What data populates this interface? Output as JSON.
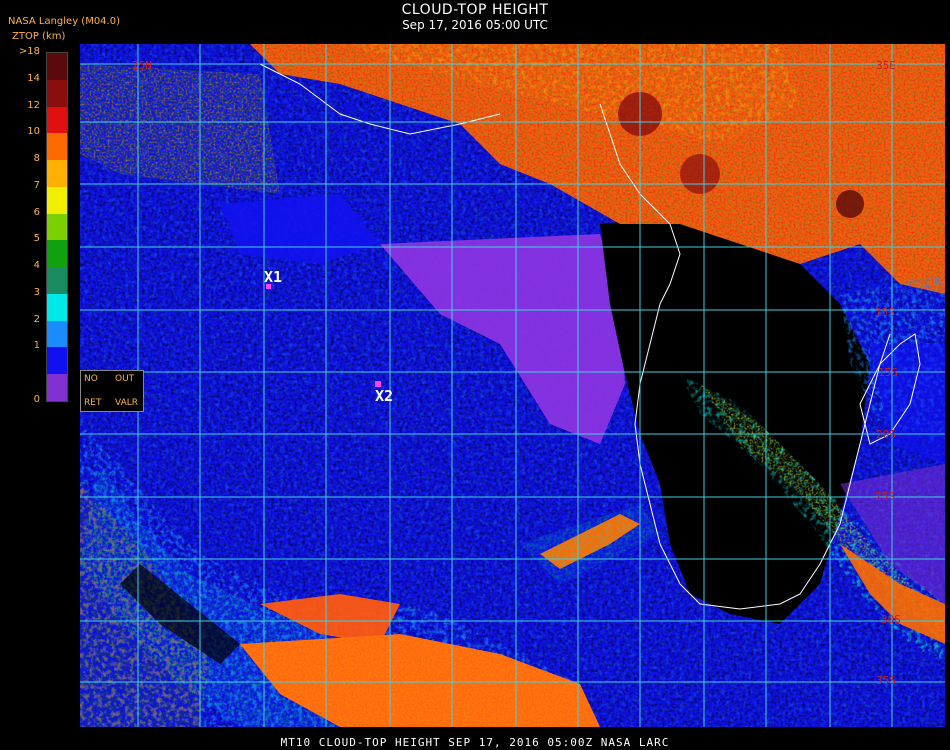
{
  "header": {
    "title": "CLOUD-TOP HEIGHT",
    "subtitle": "Sep 17, 2016 05:00 UTC",
    "source": "NASA Langley (M04.0)",
    "units": "ZTOP (km)"
  },
  "legend": {
    "levels": [
      {
        "label": ">18",
        "color": "#5a0a0a"
      },
      {
        "label": "14",
        "color": "#8b0e0e"
      },
      {
        "label": "12",
        "color": "#e01010"
      },
      {
        "label": "10",
        "color": "#ff6a00"
      },
      {
        "label": "8",
        "color": "#ffb000"
      },
      {
        "label": "7",
        "color": "#f0f000"
      },
      {
        "label": "6",
        "color": "#7cd000"
      },
      {
        "label": "5",
        "color": "#10a010"
      },
      {
        "label": "4",
        "color": "#1a8a60"
      },
      {
        "label": "3",
        "color": "#00e8e8"
      },
      {
        "label": "2",
        "color": "#1a8cff"
      },
      {
        "label": "1",
        "color": "#1010f0"
      },
      {
        "label": "",
        "color": "#8030d0"
      }
    ],
    "zero_label": "0"
  },
  "status_labels": {
    "no": "NO",
    "out": "OUT",
    "ret": "RET",
    "valr": "VALR"
  },
  "markers": [
    {
      "label": "X1"
    },
    {
      "label": "X2"
    }
  ],
  "lat_labels": [
    "25N",
    "35E",
    "15S",
    "15S",
    "20S",
    "25S",
    "30S",
    "35S"
  ],
  "footer": "MT10  CLOUD-TOP HEIGHT  SEP 17, 2016 05:00Z  NASA LARC"
}
